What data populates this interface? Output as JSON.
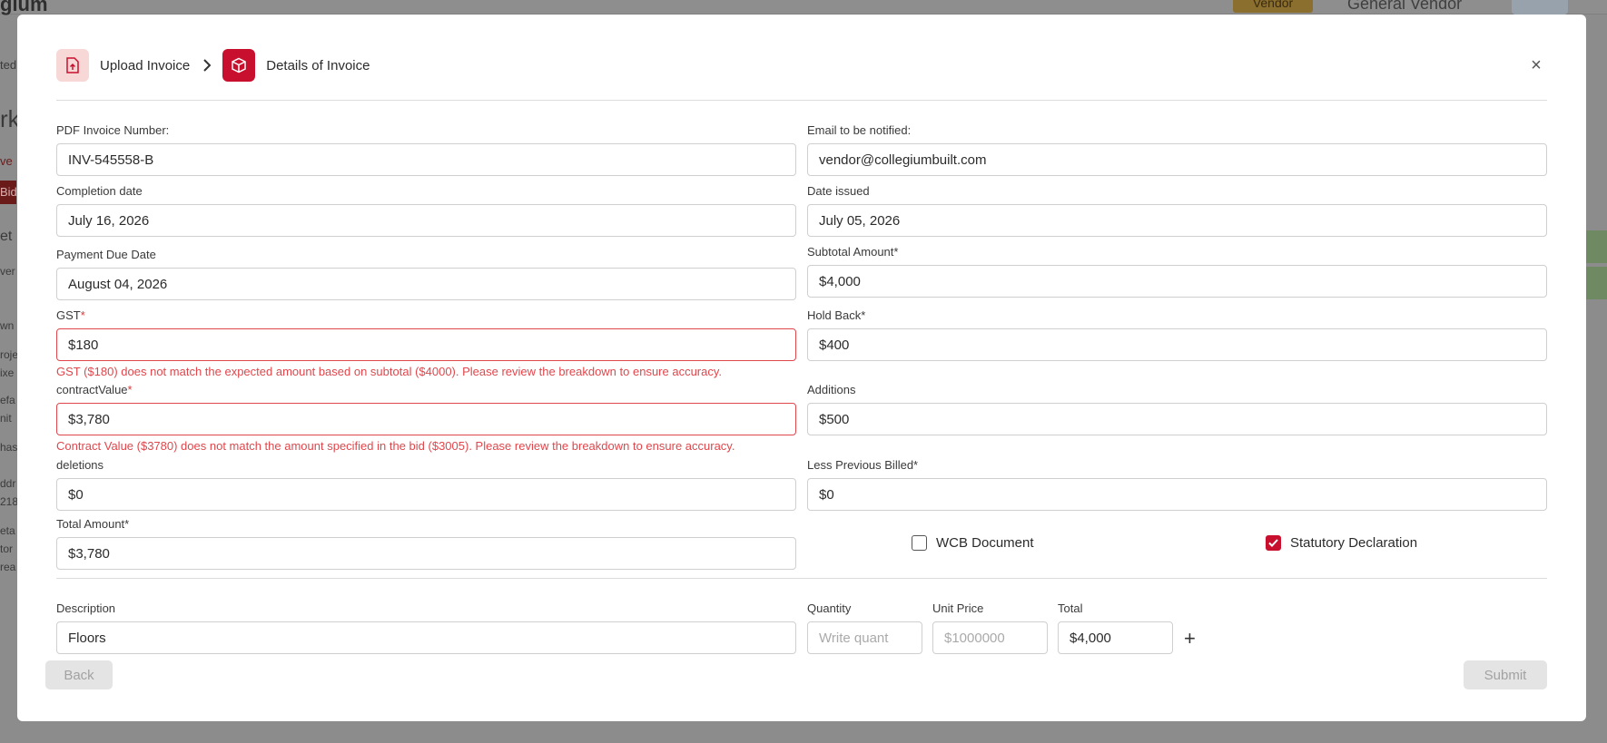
{
  "background": {
    "logo": "gium",
    "vendor_badge": "Vendor",
    "general_vendor": "General Vendor",
    "left_fragments": [
      "ted",
      "rk",
      "ve",
      "Bid",
      "et E",
      "ver",
      "wn",
      "roje",
      "ixe",
      "efa",
      "nit",
      "has",
      "ddr",
      "218",
      "eta",
      "tor",
      "rea"
    ]
  },
  "header": {
    "step1_label": "Upload Invoice",
    "step2_label": "Details of Invoice",
    "close_label": "×"
  },
  "form": {
    "pdf_invoice_number": {
      "label": "PDF Invoice Number:",
      "value": "INV-545558-B"
    },
    "email_notified": {
      "label": "Email to be notified:",
      "value": "vendor@collegiumbuilt.com"
    },
    "completion_date": {
      "label": "Completion date",
      "value": "July 16, 2026"
    },
    "date_issued": {
      "label": "Date issued",
      "value": "July 05, 2026"
    },
    "payment_due_date": {
      "label": "Payment Due Date",
      "value": "August 04, 2026"
    },
    "subtotal_amount": {
      "label": "Subtotal Amount*",
      "value": "$4,000"
    },
    "gst": {
      "label": "GST",
      "required_mark": "*",
      "value": "$180",
      "error": "GST ($180) does not match the expected amount based on subtotal ($4000). Please review the breakdown to ensure accuracy."
    },
    "hold_back": {
      "label": "Hold Back*",
      "value": "$400"
    },
    "contract_value": {
      "label": "contractValue",
      "required_mark": "*",
      "value": "$3,780",
      "error": "Contract Value ($3780) does not match the amount specified in the bid ($3005). Please review the breakdown to ensure accuracy."
    },
    "additions": {
      "label": "Additions",
      "value": "$500"
    },
    "deletions": {
      "label": "deletions",
      "value": "$0"
    },
    "less_previous_billed": {
      "label": "Less Previous Billed*",
      "value": "$0"
    },
    "total_amount": {
      "label": "Total Amount*",
      "value": "$3,780"
    },
    "wcb_document": {
      "label": "WCB Document",
      "checked": false
    },
    "statutory_declaration": {
      "label": "Statutory Declaration",
      "checked": true
    }
  },
  "line_item": {
    "description": {
      "label": "Description",
      "value": "Floors"
    },
    "quantity": {
      "label": "Quantity",
      "placeholder": "Write quant"
    },
    "unit_price": {
      "label": "Unit Price",
      "placeholder": "$1000000"
    },
    "total": {
      "label": "Total",
      "value": "$4,000"
    },
    "add_label": "+"
  },
  "footer": {
    "back_label": "Back",
    "submit_label": "Submit"
  },
  "colors": {
    "accent": "#c8102e",
    "error": "#e0474c",
    "disabled_bg": "#e4e4e4"
  }
}
